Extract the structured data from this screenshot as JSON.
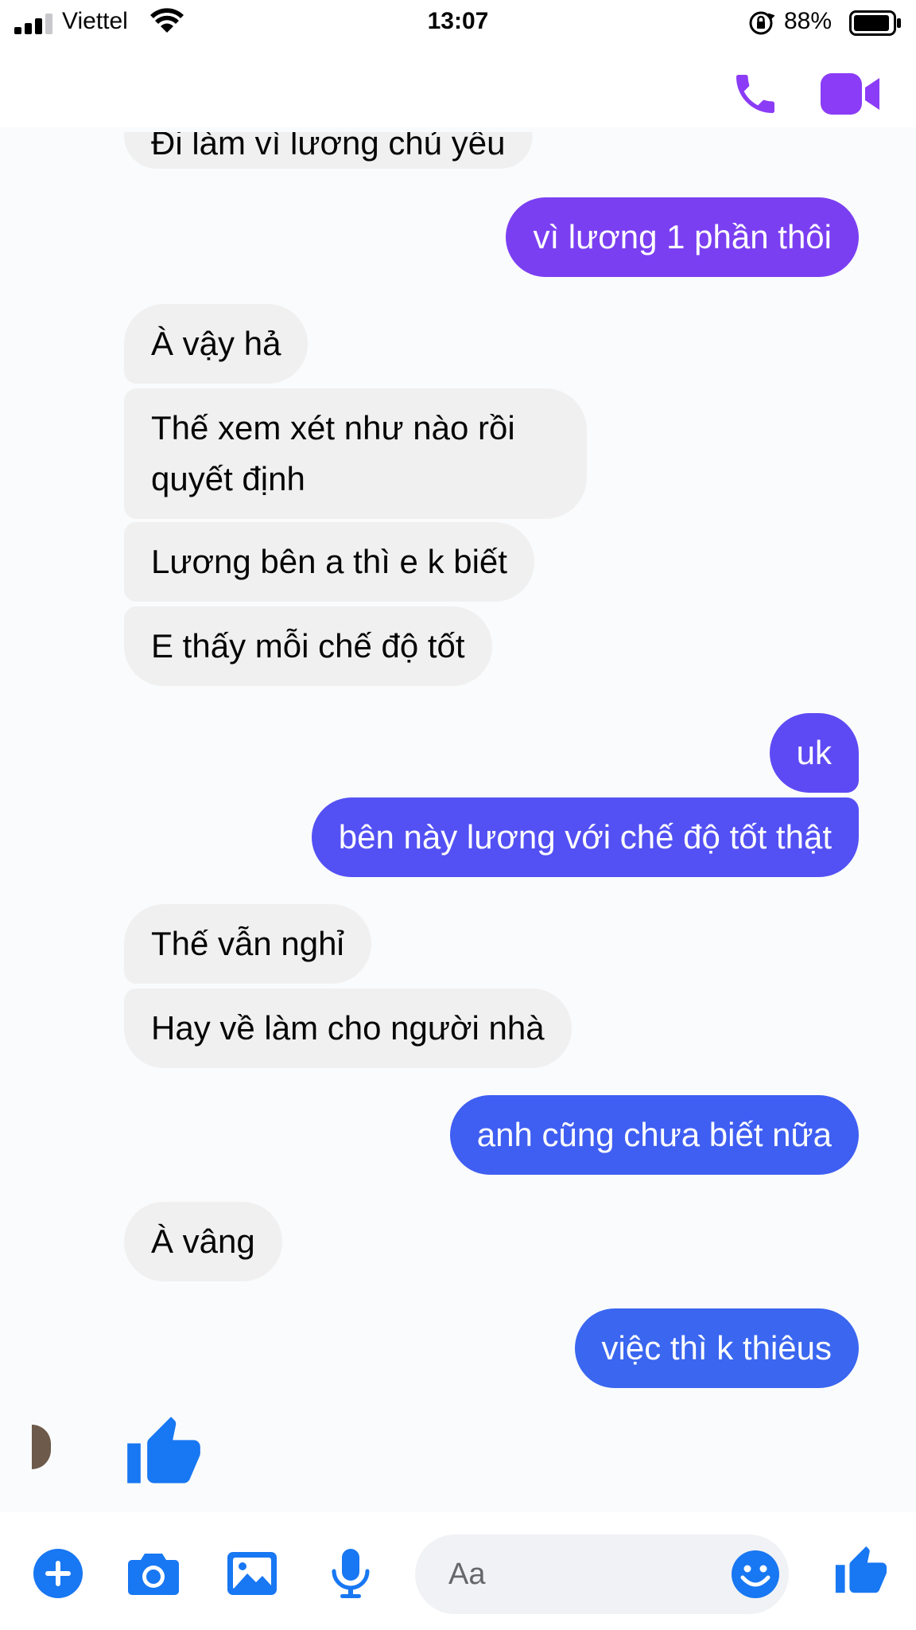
{
  "status_bar": {
    "carrier": "Viettel",
    "time": "13:07",
    "battery_percent": "88%"
  },
  "colors": {
    "accent_purple": "#8b3cf6",
    "out_purple": "#7b3ff2",
    "out_indigo": "#5a4ff5",
    "out_blue": "#3c63f0",
    "messenger_blue": "#1877f2",
    "incoming_bg": "#f0f0f0"
  },
  "header": {
    "actions": [
      {
        "icon": "phone-icon"
      },
      {
        "icon": "video-camera-icon"
      }
    ]
  },
  "messages": [
    {
      "from": "them",
      "text": "Đi làm vì lương chủ yếu",
      "partial": true
    },
    {
      "from": "me",
      "text": "vì lương 1 phần thôi"
    },
    {
      "from": "them",
      "text": "À vậy hả"
    },
    {
      "from": "them",
      "text": "Thế xem xét như nào rồi quyết định"
    },
    {
      "from": "them",
      "text": "Lương bên a thì e k biết"
    },
    {
      "from": "them",
      "text": "E thấy mỗi chế độ tốt"
    },
    {
      "from": "me",
      "text": "uk"
    },
    {
      "from": "me",
      "text": "bên này lương với chế độ tốt thật"
    },
    {
      "from": "them",
      "text": "Thế vẫn nghỉ"
    },
    {
      "from": "them",
      "text": "Hay về làm cho người nhà"
    },
    {
      "from": "me",
      "text": "anh cũng chưa biết nữa"
    },
    {
      "from": "them",
      "text": "À vâng"
    },
    {
      "from": "me",
      "text": "việc thì k thiêus"
    },
    {
      "from": "them",
      "sticker": "thumbs-up-icon"
    }
  ],
  "composer": {
    "placeholder": "Aa",
    "icons": [
      "plus-icon",
      "camera-icon",
      "image-icon",
      "microphone-icon",
      "emoji-icon",
      "thumbs-up-icon"
    ]
  }
}
